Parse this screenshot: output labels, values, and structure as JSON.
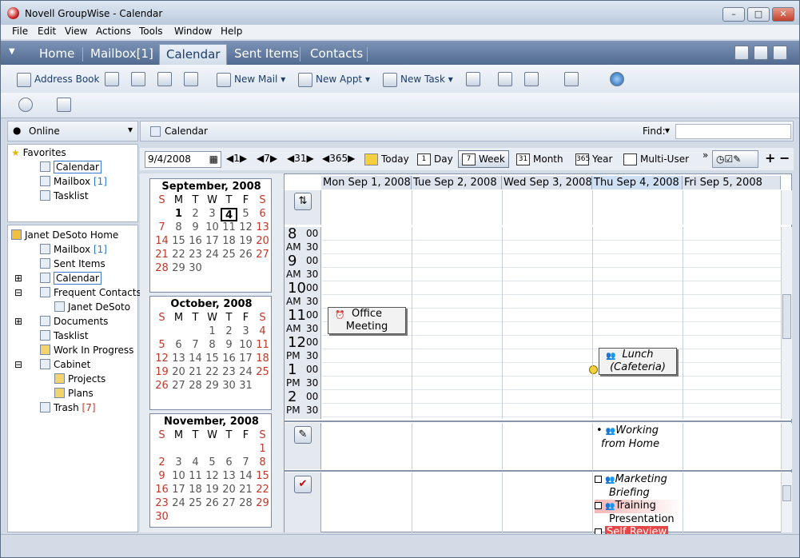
{
  "window": {
    "title": "Novell GroupWise - Calendar"
  },
  "menu": [
    "File",
    "Edit",
    "View",
    "Actions",
    "Tools",
    "Window",
    "Help"
  ],
  "nav_tabs": [
    "Home",
    "Mailbox[1]",
    "Calendar",
    "Sent Items",
    "Contacts"
  ],
  "toolbar": {
    "address_book": "Address Book",
    "new_mail": "New Mail",
    "new_appt": "New Appt",
    "new_task": "New Task"
  },
  "online": "Online",
  "favorites": {
    "label": "Favorites",
    "items": [
      {
        "label": "Calendar"
      },
      {
        "label": "Mailbox",
        "count": "[1]"
      },
      {
        "label": "Tasklist"
      }
    ]
  },
  "tree": {
    "root": "Janet DeSoto Home",
    "items": [
      {
        "label": "Mailbox",
        "count": "[1]"
      },
      {
        "label": "Sent Items"
      },
      {
        "label": "Calendar"
      },
      {
        "label": "Frequent Contacts"
      },
      {
        "label": "Janet DeSoto"
      },
      {
        "label": "Documents"
      },
      {
        "label": "Tasklist"
      },
      {
        "label": "Work In Progress"
      },
      {
        "label": "Cabinet"
      },
      {
        "label": "Projects"
      },
      {
        "label": "Plans"
      },
      {
        "label": "Trash",
        "count": "[7]"
      }
    ]
  },
  "calendar_bar": {
    "title": "Calendar",
    "find_label": "Find:"
  },
  "date_bar": {
    "date": "9/4/2008",
    "steps": [
      "1",
      "7",
      "31",
      "365"
    ],
    "views": [
      {
        "num": "",
        "label": "Today"
      },
      {
        "num": "1",
        "label": "Day"
      },
      {
        "num": "7",
        "label": "Week"
      },
      {
        "num": "31",
        "label": "Month"
      },
      {
        "num": "365",
        "label": "Year"
      },
      {
        "num": "",
        "label": "Multi-User"
      }
    ],
    "plus": "+",
    "minus": "−"
  },
  "weekday_letters": [
    "S",
    "M",
    "T",
    "W",
    "T",
    "F",
    "S"
  ],
  "months": [
    {
      "title": "September, 2008",
      "start": 1,
      "days": 30,
      "today": 4
    },
    {
      "title": "October, 2008",
      "start": 3,
      "days": 31
    },
    {
      "title": "November, 2008",
      "start": 6,
      "days": 30
    }
  ],
  "day_headers": [
    "Mon Sep 1, 2008",
    "Tue Sep 2, 2008",
    "Wed Sep 3, 2008",
    "Thu Sep 4, 2008",
    "Fri Sep 5, 2008"
  ],
  "hours": [
    {
      "h": "8",
      "ap": "AM"
    },
    {
      "h": "9",
      "ap": "AM"
    },
    {
      "h": "10",
      "ap": "AM"
    },
    {
      "h": "11",
      "ap": "AM"
    },
    {
      "h": "12",
      "ap": "PM"
    },
    {
      "h": "1",
      "ap": "PM"
    },
    {
      "h": "2",
      "ap": "PM"
    }
  ],
  "minutes": [
    "00",
    "30"
  ],
  "appointments": [
    {
      "title": "Office Meeting",
      "line1": "Office",
      "line2": "Meeting"
    },
    {
      "title": "Lunch (Cafeteria)",
      "line1": "Lunch",
      "line2": "(Cafeteria)"
    }
  ],
  "reminder_note": {
    "line1": "Working",
    "line2": "from Home"
  },
  "tasks": [
    {
      "line1": "Marketing",
      "line2": "Briefing"
    },
    {
      "line1": "Training",
      "line2": "Presentation"
    },
    {
      "line1": "Self Review"
    }
  ]
}
